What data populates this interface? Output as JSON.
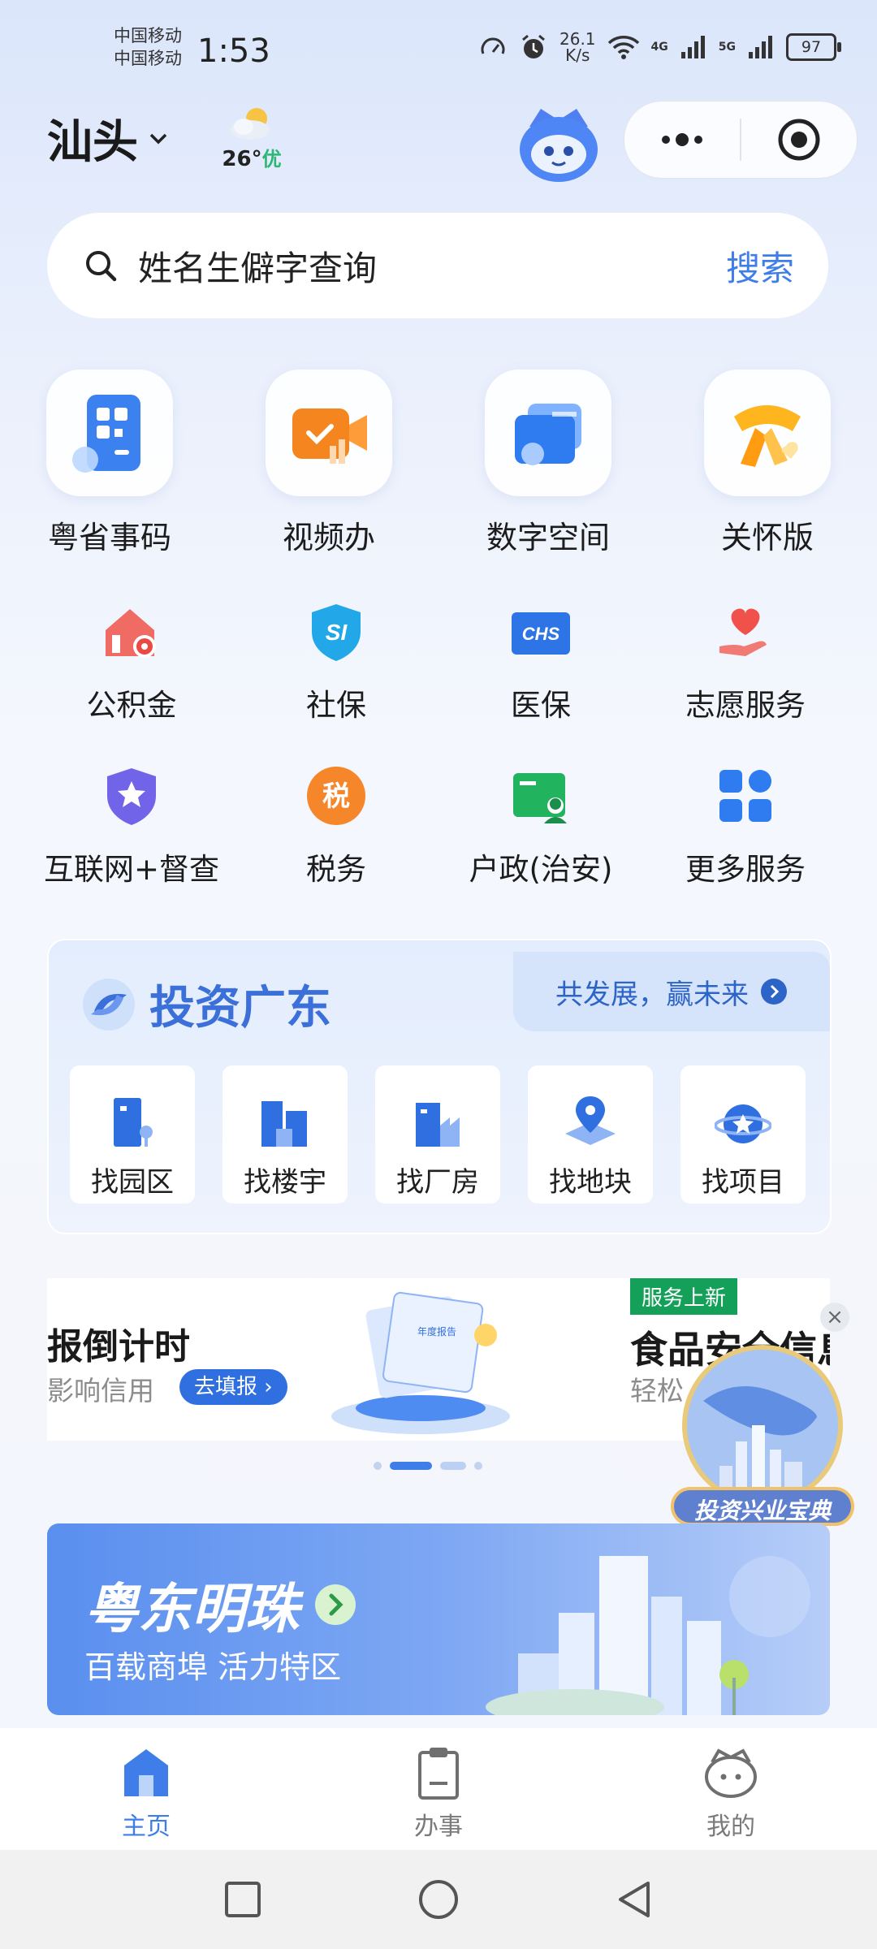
{
  "status_bar": {
    "carrier1": "中国移动",
    "carrier2": "中国移动",
    "time": "1:53",
    "speed_value": "26.1",
    "speed_unit": "K/s",
    "net1": "4G",
    "net2": "5G",
    "battery": "97"
  },
  "header": {
    "city": "汕头",
    "temperature": "26°",
    "air_quality": "优"
  },
  "search": {
    "placeholder": "姓名生僻字查询",
    "button": "搜索"
  },
  "main_services": [
    {
      "label": "粤省事码",
      "icon": "qr-code-icon"
    },
    {
      "label": "视频办",
      "icon": "video-camera-icon"
    },
    {
      "label": "数字空间",
      "icon": "digital-space-icon"
    },
    {
      "label": "关怀版",
      "icon": "care-scarf-icon"
    }
  ],
  "services_row1": [
    {
      "label": "公积金",
      "icon": "housing-fund-icon"
    },
    {
      "label": "社保",
      "icon": "social-security-icon"
    },
    {
      "label": "医保",
      "icon": "medical-insurance-icon"
    },
    {
      "label": "志愿服务",
      "icon": "volunteer-heart-icon"
    }
  ],
  "services_row2": [
    {
      "label": "互联网+督查",
      "icon": "supervision-badge-icon"
    },
    {
      "label": "税务",
      "icon": "tax-icon",
      "glyph": "税"
    },
    {
      "label": "户政(治安)",
      "icon": "household-id-icon"
    },
    {
      "label": "更多服务",
      "icon": "more-grid-icon"
    }
  ],
  "invest": {
    "title": "投资广东",
    "slogan": "共发展，赢未来",
    "finders": [
      {
        "label": "找园区",
        "icon": "park-icon"
      },
      {
        "label": "找楼宇",
        "icon": "building-icon"
      },
      {
        "label": "找厂房",
        "icon": "factory-icon"
      },
      {
        "label": "找地块",
        "icon": "land-pin-icon"
      },
      {
        "label": "找项目",
        "icon": "project-icon"
      }
    ]
  },
  "banner": {
    "title": "报倒计时",
    "subtitle": "影响信用",
    "button": "去填报",
    "report_label": "年度报告",
    "tag": "服务上新",
    "title2": "食品安全信息",
    "subtitle2": "轻松"
  },
  "float_ad": {
    "label": "投资兴业宝典"
  },
  "pearl": {
    "title": "粤东明珠",
    "subtitle": "百载商埠  活力特区"
  },
  "tabs": [
    {
      "label": "主页",
      "icon": "home-icon",
      "active": true
    },
    {
      "label": "办事",
      "icon": "clipboard-icon",
      "active": false
    },
    {
      "label": "我的",
      "icon": "profile-mascot-icon",
      "active": false
    }
  ],
  "colors": {
    "accent": "#3f7ee8",
    "good_air": "#2bb673",
    "new_tag": "#15a05a"
  }
}
